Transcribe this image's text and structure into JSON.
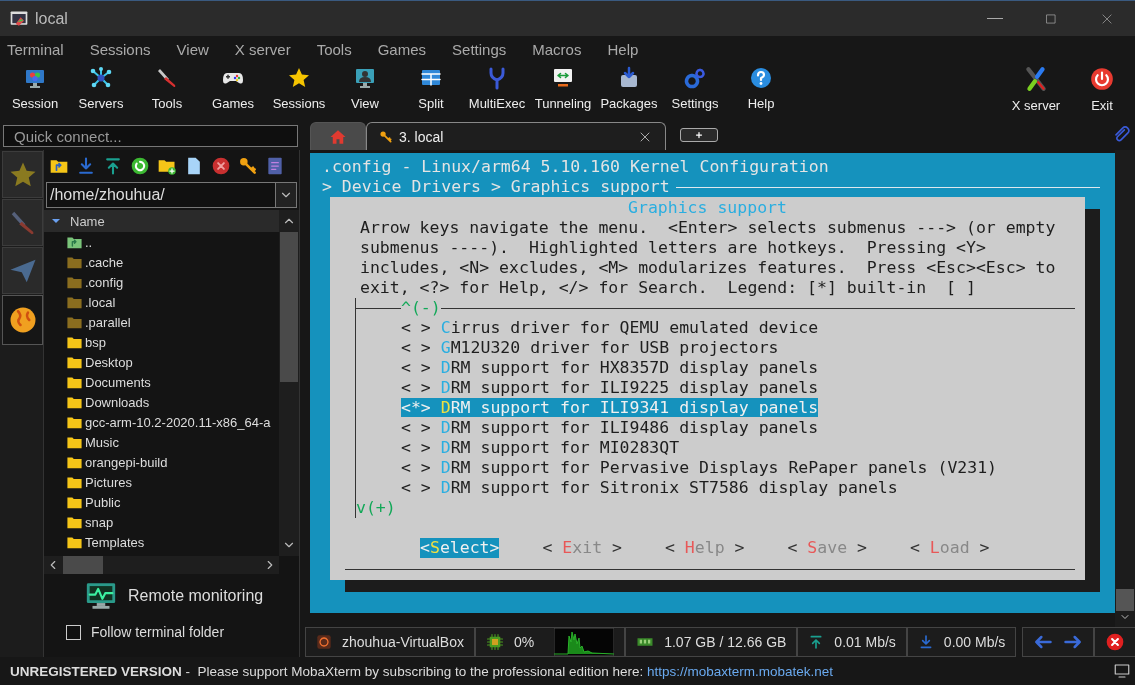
{
  "window": {
    "title": "local"
  },
  "menu": [
    "Terminal",
    "Sessions",
    "View",
    "X server",
    "Tools",
    "Games",
    "Settings",
    "Macros",
    "Help"
  ],
  "toolbar": {
    "left": [
      {
        "label": "Session"
      },
      {
        "label": "Servers"
      },
      {
        "label": "Tools"
      },
      {
        "label": "Games"
      },
      {
        "label": "Sessions"
      },
      {
        "label": "View"
      },
      {
        "label": "Split"
      },
      {
        "label": "MultiExec"
      },
      {
        "label": "Tunneling"
      },
      {
        "label": "Packages"
      },
      {
        "label": "Settings"
      },
      {
        "label": "Help"
      }
    ],
    "right": [
      {
        "label": "X server"
      },
      {
        "label": "Exit"
      }
    ]
  },
  "quick_connect": {
    "placeholder": "Quick connect..."
  },
  "tabs": [
    {
      "kind": "home",
      "selected": false
    },
    {
      "kind": "session",
      "label": "3. local",
      "selected": true
    }
  ],
  "sidebar": {
    "tabs": [
      {
        "selected": false
      },
      {
        "selected": false
      },
      {
        "selected": false
      },
      {
        "selected": true
      }
    ]
  },
  "file_browser": {
    "path": "/home/zhouhua/",
    "column": "Name",
    "items": [
      {
        "name": "..",
        "kind": "parent"
      },
      {
        "name": ".cache",
        "kind": "hidden"
      },
      {
        "name": ".config",
        "kind": "hidden"
      },
      {
        "name": ".local",
        "kind": "hidden"
      },
      {
        "name": ".parallel",
        "kind": "hidden"
      },
      {
        "name": "bsp",
        "kind": "folder"
      },
      {
        "name": "Desktop",
        "kind": "folder"
      },
      {
        "name": "Documents",
        "kind": "folder"
      },
      {
        "name": "Downloads",
        "kind": "folder"
      },
      {
        "name": "gcc-arm-10.2-2020.11-x86_64-a",
        "kind": "folder"
      },
      {
        "name": "Music",
        "kind": "folder"
      },
      {
        "name": "orangepi-build",
        "kind": "folder"
      },
      {
        "name": "Pictures",
        "kind": "folder"
      },
      {
        "name": "Public",
        "kind": "folder"
      },
      {
        "name": "snap",
        "kind": "folder"
      },
      {
        "name": "Templates",
        "kind": "folder"
      }
    ]
  },
  "remote_monitoring": {
    "label": "Remote monitoring"
  },
  "follow_terminal_folder": {
    "label": "Follow terminal folder",
    "checked": false
  },
  "terminal": {
    "title_line": ".config - Linux/arm64 5.10.160 Kernel Configuration",
    "breadcrumb": "> Device Drivers > Graphics support",
    "dialog": {
      "title": "Graphics support",
      "help_lines": [
        "Arrow keys navigate the menu.  <Enter> selects submenus ---> (or empty",
        "submenus ----).  Highlighted letters are hotkeys.  Pressing <Y>",
        "includes, <N> excludes, <M> modularizes features.  Press <Esc><Esc> to",
        "exit, <?> for Help, </> for Search.  Legend: [*] built-in  [ ]"
      ],
      "scroll_up": "^(-)",
      "items": [
        {
          "state": "< >",
          "hotkey": "C",
          "rest": "irrus driver for QEMU emulated device",
          "selected": false
        },
        {
          "state": "< >",
          "hotkey": "G",
          "rest": "M12U320 driver for USB projectors",
          "selected": false
        },
        {
          "state": "< >",
          "hotkey": "D",
          "rest": "RM support for HX8357D display panels",
          "selected": false
        },
        {
          "state": "< >",
          "hotkey": "D",
          "rest": "RM support for ILI9225 display panels",
          "selected": false
        },
        {
          "state": "<*>",
          "hotkey": "D",
          "rest": "RM support for ILI9341 display panels",
          "selected": true
        },
        {
          "state": "< >",
          "hotkey": "D",
          "rest": "RM support for ILI9486 display panels",
          "selected": false
        },
        {
          "state": "< >",
          "hotkey": "D",
          "rest": "RM support for MI0283QT",
          "selected": false
        },
        {
          "state": "< >",
          "hotkey": "D",
          "rest": "RM support for Pervasive Displays RePaper panels (V231)",
          "selected": false
        },
        {
          "state": "< >",
          "hotkey": "D",
          "rest": "RM support for Sitronix ST7586 display panels",
          "selected": false
        }
      ],
      "scroll_down": "v(+)",
      "buttons": [
        {
          "open": "<",
          "hotkey": "S",
          "rest": "elect",
          "close": ">",
          "selected": true
        },
        {
          "open": "< ",
          "hotkey": "E",
          "rest": "xit",
          "close": " >",
          "selected": false
        },
        {
          "open": "< ",
          "hotkey": "H",
          "rest": "elp",
          "close": " >",
          "selected": false
        },
        {
          "open": "< ",
          "hotkey": "S",
          "rest": "ave",
          "close": " >",
          "selected": false
        },
        {
          "open": "< ",
          "hotkey": "L",
          "rest": "oad",
          "close": " >",
          "selected": false
        }
      ]
    }
  },
  "status_bar": {
    "host": "zhouhua-VirtualBox",
    "cpu": "0%",
    "memory": "1.07 GB / 12.66 GB",
    "upload": "0.01 Mb/s",
    "download": "0.00 Mb/s"
  },
  "banner": {
    "title": "UNREGISTERED VERSION",
    "message": " -  Please support MobaXterm by subscribing to the professional edition here: ",
    "link": "https://mobaxterm.mobatek.net"
  }
}
